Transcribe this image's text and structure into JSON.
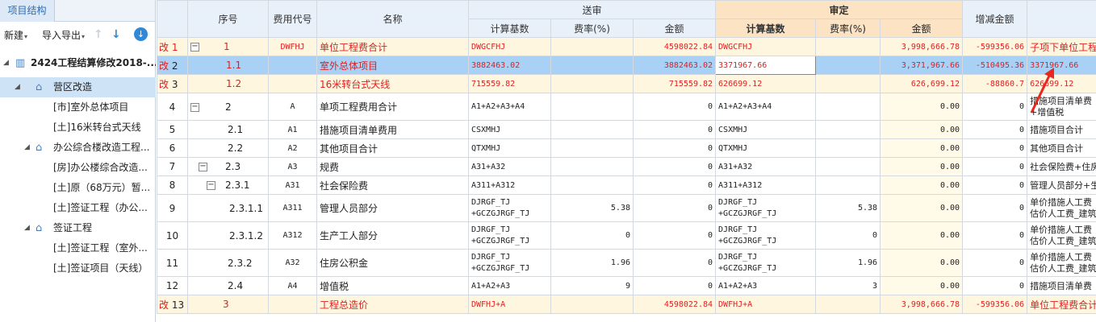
{
  "sidebar": {
    "tab": "项目结构",
    "toolbar": {
      "new_label": "新建",
      "import_export_label": "导入导出"
    },
    "tree": [
      {
        "label": "2424工程结算修改2018-...",
        "level": 0
      },
      {
        "label": "营区改造",
        "level": 1
      },
      {
        "label": "[市]室外总体项目",
        "level": 2
      },
      {
        "label": "[土]16米转台式天线",
        "level": 2
      },
      {
        "label": "办公综合楼改造工程...",
        "level": 1
      },
      {
        "label": "[房]办公楼综合改造...",
        "level": 2
      },
      {
        "label": "[土]原（68万元）暂...",
        "level": 2
      },
      {
        "label": "[土]签证工程（办公...",
        "level": 2
      },
      {
        "label": "签证工程",
        "level": 1
      },
      {
        "label": "[土]签证工程（室外...",
        "level": 2
      },
      {
        "label": "[土]签证项目（天线）",
        "level": 2
      }
    ]
  },
  "grid": {
    "headers": {
      "seq": "序号",
      "code": "费用代号",
      "name": "名称",
      "submitted": "送审",
      "audited": "审定",
      "calc_base": "计算基数",
      "rate": "费率(%)",
      "amount": "金额",
      "diff": "增减金额"
    },
    "rows": [
      {
        "mark": "改",
        "idx": "1",
        "seq": "1",
        "code": "DWFHJ",
        "name": "单位工程费合计",
        "s_base": "DWGCFHJ",
        "s_rate": "",
        "s_amt": "4598022.84",
        "a_base": "DWGCFHJ",
        "a_rate": "",
        "a_amt": "3,998,666.78",
        "diff": "-599356.06",
        "note": "子项下单位工程"
      },
      {
        "mark": "改",
        "idx": "2",
        "seq": "1.1",
        "code": "",
        "name": "室外总体项目",
        "s_base": "3882463.02",
        "s_rate": "",
        "s_amt": "3882463.02",
        "a_base": "3371967.66",
        "a_rate": "",
        "a_amt": "3,371,967.66",
        "diff": "-510495.36",
        "note": "3371967.66"
      },
      {
        "mark": "改",
        "idx": "3",
        "seq": "1.2",
        "code": "",
        "name": "16米转台式天线",
        "s_base": "715559.82",
        "s_rate": "",
        "s_amt": "715559.82",
        "a_base": "626699.12",
        "a_rate": "",
        "a_amt": "626,699.12",
        "diff": "-88860.7",
        "note": "626699.12"
      },
      {
        "mark": "",
        "idx": "4",
        "seq": "2",
        "code": "A",
        "name": "单项工程费用合计",
        "s_base": "A1+A2+A3+A4",
        "s_rate": "",
        "s_amt": "0",
        "a_base": "A1+A2+A3+A4",
        "a_rate": "",
        "a_amt": "0.00",
        "diff": "0",
        "note": "措施项目清单费",
        "note2": "+增值税"
      },
      {
        "mark": "",
        "idx": "5",
        "seq": "2.1",
        "code": "A1",
        "name": "措施项目清单费用",
        "s_base": "CSXMHJ",
        "s_rate": "",
        "s_amt": "0",
        "a_base": "CSXMHJ",
        "a_rate": "",
        "a_amt": "0.00",
        "diff": "0",
        "note": "措施项目合计"
      },
      {
        "mark": "",
        "idx": "6",
        "seq": "2.2",
        "code": "A2",
        "name": "其他项目合计",
        "s_base": "QTXMHJ",
        "s_rate": "",
        "s_amt": "0",
        "a_base": "QTXMHJ",
        "a_rate": "",
        "a_amt": "0.00",
        "diff": "0",
        "note": "其他项目合计"
      },
      {
        "mark": "",
        "idx": "7",
        "seq": "2.3",
        "code": "A3",
        "name": "规费",
        "s_base": "A31+A32",
        "s_rate": "",
        "s_amt": "0",
        "a_base": "A31+A32",
        "a_rate": "",
        "a_amt": "0.00",
        "diff": "0",
        "note": "社会保险费+住房"
      },
      {
        "mark": "",
        "idx": "8",
        "seq": "2.3.1",
        "code": "A31",
        "name": "社会保险费",
        "s_base": "A311+A312",
        "s_rate": "",
        "s_amt": "0",
        "a_base": "A311+A312",
        "a_rate": "",
        "a_amt": "0.00",
        "diff": "0",
        "note": "管理人员部分+生"
      },
      {
        "mark": "",
        "idx": "9",
        "seq": "2.3.1.1",
        "code": "A311",
        "name": "管理人员部分",
        "s_base": "DJRGF_TJ",
        "s_base2": "+GCZGJRGF_TJ",
        "s_rate": "5.38",
        "s_amt": "0",
        "a_base": "DJRGF_TJ",
        "a_base2": "+GCZGJRGF_TJ",
        "a_rate": "5.38",
        "a_amt": "0.00",
        "diff": "0",
        "note": "单价措施人工费",
        "note2": "估价人工费_建筑"
      },
      {
        "mark": "",
        "idx": "10",
        "seq": "2.3.1.2",
        "code": "A312",
        "name": "生产工人部分",
        "s_base": "DJRGF_TJ",
        "s_base2": "+GCZGJRGF_TJ",
        "s_rate": "0",
        "s_amt": "0",
        "a_base": "DJRGF_TJ",
        "a_base2": "+GCZGJRGF_TJ",
        "a_rate": "0",
        "a_amt": "0.00",
        "diff": "0",
        "note": "单价措施人工费",
        "note2": "估价人工费_建筑"
      },
      {
        "mark": "",
        "idx": "11",
        "seq": "2.3.2",
        "code": "A32",
        "name": "住房公积金",
        "s_base": "DJRGF_TJ",
        "s_base2": "+GCZGJRGF_TJ",
        "s_rate": "1.96",
        "s_amt": "0",
        "a_base": "DJRGF_TJ",
        "a_base2": "+GCZGJRGF_TJ",
        "a_rate": "1.96",
        "a_amt": "0.00",
        "diff": "0",
        "note": "单价措施人工费",
        "note2": "估价人工费_建筑"
      },
      {
        "mark": "",
        "idx": "12",
        "seq": "2.4",
        "code": "A4",
        "name": "增值税",
        "s_base": "A1+A2+A3",
        "s_rate": "9",
        "s_amt": "0",
        "a_base": "A1+A2+A3",
        "a_rate": "3",
        "a_amt": "0.00",
        "diff": "0",
        "note": "措施项目清单费"
      },
      {
        "mark": "改",
        "idx": "13",
        "seq": "3",
        "code": "",
        "name": "工程总造价",
        "s_base": "DWFHJ+A",
        "s_rate": "",
        "s_amt": "4598022.84",
        "a_base": "DWFHJ+A",
        "a_rate": "",
        "a_amt": "3,998,666.78",
        "diff": "-599356.06",
        "note": "单位工程费合计"
      }
    ]
  },
  "colors": {
    "changed": "#e02020",
    "selected_row": "#a8d1f5",
    "audit_header": "#fbe3c4",
    "annotation_arrow": "#e8281e"
  }
}
